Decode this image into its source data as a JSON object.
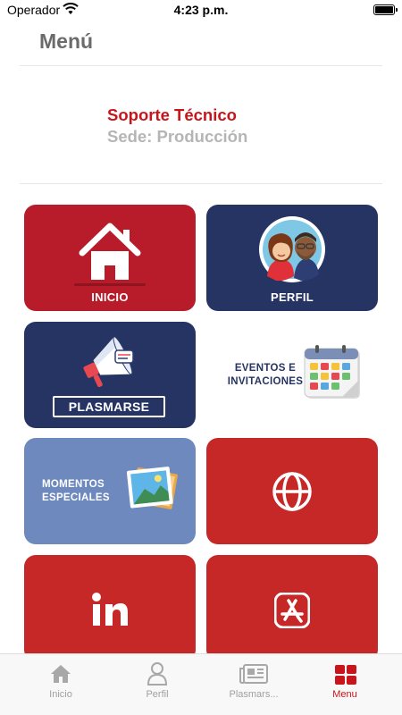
{
  "status_bar": {
    "carrier": "Operador",
    "time": "4:23 p.m."
  },
  "header": {
    "title": "Menú"
  },
  "user": {
    "name": "Soporte Técnico",
    "sede": "Sede: Producción"
  },
  "tiles": {
    "inicio": {
      "label": "INICIO",
      "icon": "home-icon"
    },
    "perfil": {
      "label": "PERFIL",
      "icon": "avatars-icon"
    },
    "plasmarse": {
      "label": "PLASMARSE",
      "icon": "megaphone-icon"
    },
    "eventos": {
      "line1": "EVENTOS E",
      "line2": "INVITACIONES",
      "icon": "calendar-icon"
    },
    "momentos": {
      "line1": "MOMENTOS",
      "line2": "ESPECIALES",
      "icon": "photos-icon"
    },
    "web": {
      "icon": "globe-icon"
    },
    "linkedin": {
      "icon": "linkedin-icon"
    },
    "appstore": {
      "icon": "app-store-icon"
    }
  },
  "tabbar": {
    "items": [
      {
        "label": "Inicio",
        "icon": "home-icon",
        "active": false
      },
      {
        "label": "Perfil",
        "icon": "person-icon",
        "active": false
      },
      {
        "label": "Plasmars...",
        "icon": "newspaper-icon",
        "active": false
      },
      {
        "label": "Menu",
        "icon": "grid-icon",
        "active": true
      }
    ]
  },
  "colors": {
    "brand_red": "#c8141b",
    "tile_red": "#c62727",
    "tile_navy": "#253463",
    "tile_steel": "#6d89bd",
    "inactive_gray": "#a0a0a0"
  }
}
